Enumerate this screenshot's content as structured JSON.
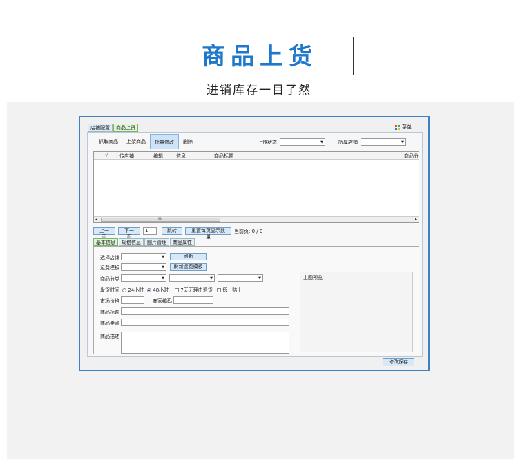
{
  "header": {
    "title": "商品上货",
    "subtitle": "进销库存一目了然"
  },
  "window": {
    "top_tabs": [
      {
        "label": "店铺配置",
        "active": false
      },
      {
        "label": "商品上货",
        "active": true
      }
    ],
    "menu_label": "菜单",
    "toolbar": [
      {
        "label": "抓取商品",
        "active": false
      },
      {
        "label": "上架商品",
        "active": false
      },
      {
        "label": "批量修改",
        "active": true
      },
      {
        "label": "删除",
        "active": false
      }
    ],
    "filters": {
      "upload_status_label": "上传状态",
      "upload_status_value": "",
      "shop_label": "所属店铺",
      "shop_value": ""
    },
    "grid": {
      "columns": [
        "√",
        "上传店铺",
        "编辑",
        "信息",
        "商品标题",
        "商品分"
      ],
      "scroll_mark": "▥",
      "rows": []
    },
    "pager": {
      "prev": "上一页",
      "next": "下一页",
      "page_value": "1",
      "jump": "跳转",
      "reset_count": "重置每页显示数量",
      "current_page_text": "当前页: 0 / 0"
    },
    "sub_tabs": [
      {
        "label": "基本信息",
        "active": true
      },
      {
        "label": "规格信息",
        "active": false
      },
      {
        "label": "图片管理",
        "active": false
      },
      {
        "label": "商品属性",
        "active": false
      }
    ],
    "form": {
      "select_shop": "选择店铺",
      "refresh": "刷新",
      "shipping_template": "运费模板",
      "refresh_shipping": "刷新运费模板",
      "category": "商品分类",
      "ship_time": "发货时间",
      "opt_24h": "24小时",
      "opt_48h": "48小时",
      "opt_7day": "7天无理由退货",
      "opt_fake": "假一赔十",
      "market_price": "市场价格",
      "merchant_code": "商家编码",
      "product_title": "商品标题",
      "selling_point": "商品卖点",
      "description": "商品描述",
      "preview_title": "主图预览",
      "save": "修改保存"
    }
  },
  "colors": {
    "title_blue": "#1f78c9",
    "window_border": "#3d82c4",
    "active_tab": "#dff5d8"
  }
}
